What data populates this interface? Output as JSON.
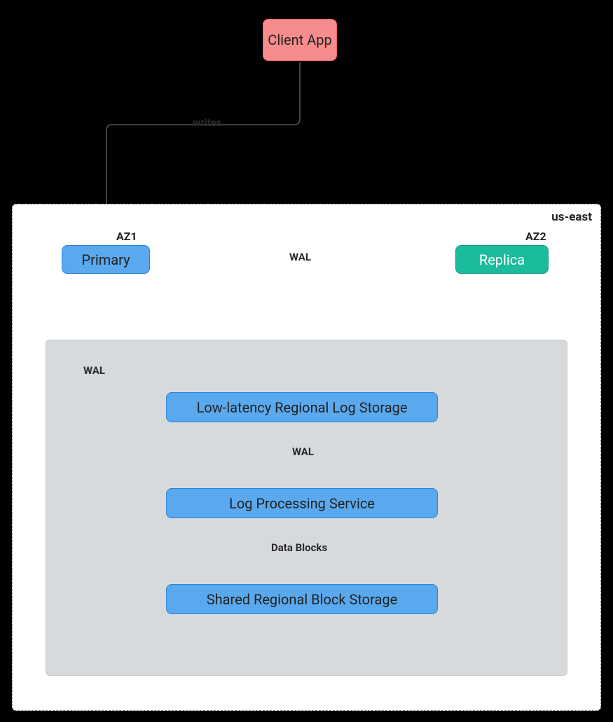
{
  "nodes": {
    "client": {
      "label": "Client App"
    },
    "primary": {
      "label": "Primary"
    },
    "replica": {
      "label": "Replica"
    },
    "log_storage": {
      "label": "Low-latency Regional Log Storage"
    },
    "log_proc": {
      "label": "Log Processing Service"
    },
    "block_storage": {
      "label": "Shared Regional Block Storage"
    }
  },
  "region": {
    "name": "us-east",
    "az1": "AZ1",
    "az2": "AZ2"
  },
  "edges": {
    "client_primary": {
      "label": "writes"
    },
    "primary_replica": {
      "label": "WAL"
    },
    "primary_log": {
      "label": "WAL"
    },
    "log_proc": {
      "label": "WAL"
    },
    "proc_block": {
      "label": "Data Blocks"
    }
  },
  "colors": {
    "green_edge": "#4CAF50",
    "dark_edge": "#545454"
  }
}
